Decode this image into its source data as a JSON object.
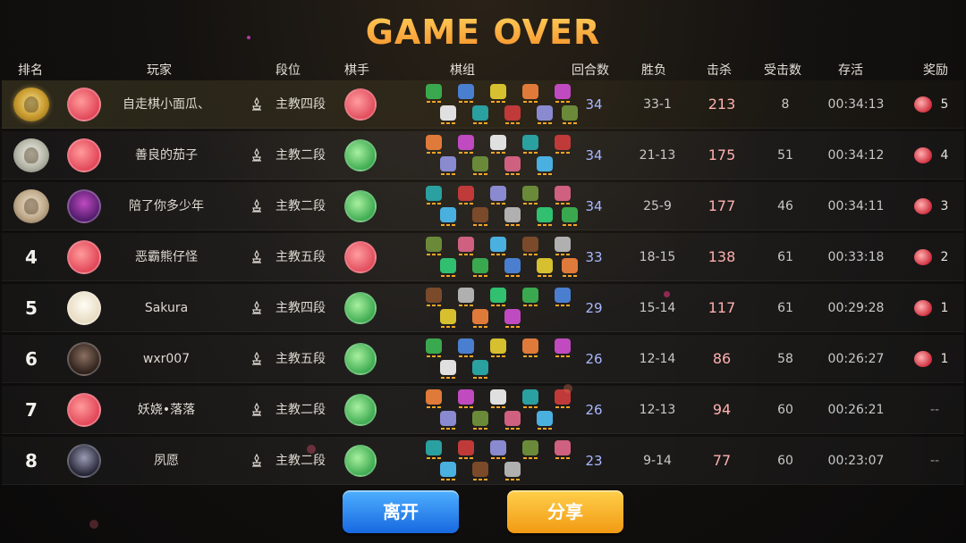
{
  "title": "GAME OVER",
  "headers": {
    "rank": "排名",
    "player": "玩家",
    "tier": "段位",
    "hero": "棋手",
    "lineup": "棋组",
    "rounds": "回合数",
    "win_loss": "胜负",
    "kills": "击杀",
    "hits_taken": "受击数",
    "survival": "存活",
    "reward": "奖励"
  },
  "rows": [
    {
      "rank": "",
      "medal": "gold",
      "avatar": "red-dragon-avatar",
      "name": "自走棋小面瓜、",
      "tier": "主教四段",
      "hero": "red",
      "rounds": "34",
      "win_loss": "33-1",
      "kills": "213",
      "hits": "8",
      "survival": "00:34:13",
      "reward": "5"
    },
    {
      "rank": "",
      "medal": "silver",
      "avatar": "red-dragon-avatar",
      "name": "善良的茄子",
      "tier": "主教二段",
      "hero": "green",
      "rounds": "34",
      "win_loss": "21-13",
      "kills": "175",
      "hits": "51",
      "survival": "00:34:12",
      "reward": "4"
    },
    {
      "rank": "",
      "medal": "bronze",
      "avatar": "purple-demon-avatar",
      "name": "陪了你多少年",
      "tier": "主教二段",
      "hero": "green",
      "rounds": "34",
      "win_loss": "25-9",
      "kills": "177",
      "hits": "46",
      "survival": "00:34:11",
      "reward": "3"
    },
    {
      "rank": "4",
      "medal": "",
      "avatar": "red-dragon-avatar",
      "name": "恶霸熊仔怪",
      "tier": "主教五段",
      "hero": "red",
      "rounds": "33",
      "win_loss": "18-15",
      "kills": "138",
      "hits": "61",
      "survival": "00:33:18",
      "reward": "2"
    },
    {
      "rank": "5",
      "medal": "",
      "avatar": "sheep-avatar",
      "name": "Sakura",
      "tier": "主教四段",
      "hero": "green",
      "rounds": "29",
      "win_loss": "15-14",
      "kills": "117",
      "hits": "61",
      "survival": "00:29:28",
      "reward": "1"
    },
    {
      "rank": "6",
      "medal": "",
      "avatar": "dark-warrior-avatar",
      "name": "wxr007",
      "tier": "主教五段",
      "hero": "green",
      "rounds": "26",
      "win_loss": "12-14",
      "kills": "86",
      "hits": "58",
      "survival": "00:26:27",
      "reward": "1"
    },
    {
      "rank": "7",
      "medal": "",
      "avatar": "red-dragon-avatar",
      "name": "妖娆•落落",
      "tier": "主教二段",
      "hero": "green",
      "rounds": "26",
      "win_loss": "12-13",
      "kills": "94",
      "hits": "60",
      "survival": "00:26:21",
      "reward": "--"
    },
    {
      "rank": "8",
      "medal": "",
      "avatar": "ninja-avatar",
      "name": "夙愿",
      "tier": "主教二段",
      "hero": "green",
      "rounds": "23",
      "win_loss": "9-14",
      "kills": "77",
      "hits": "60",
      "survival": "00:23:07",
      "reward": "--"
    }
  ],
  "buttons": {
    "leave": "离开",
    "share": "分享"
  },
  "colors": {
    "title_gradient_top": "#ffcf5a",
    "title_gradient_bottom": "#f5902a",
    "rounds_text": "#a9b8ff",
    "kills_text": "#ffb0b0",
    "leave_button": "#1768e0",
    "share_button": "#f29a14"
  }
}
